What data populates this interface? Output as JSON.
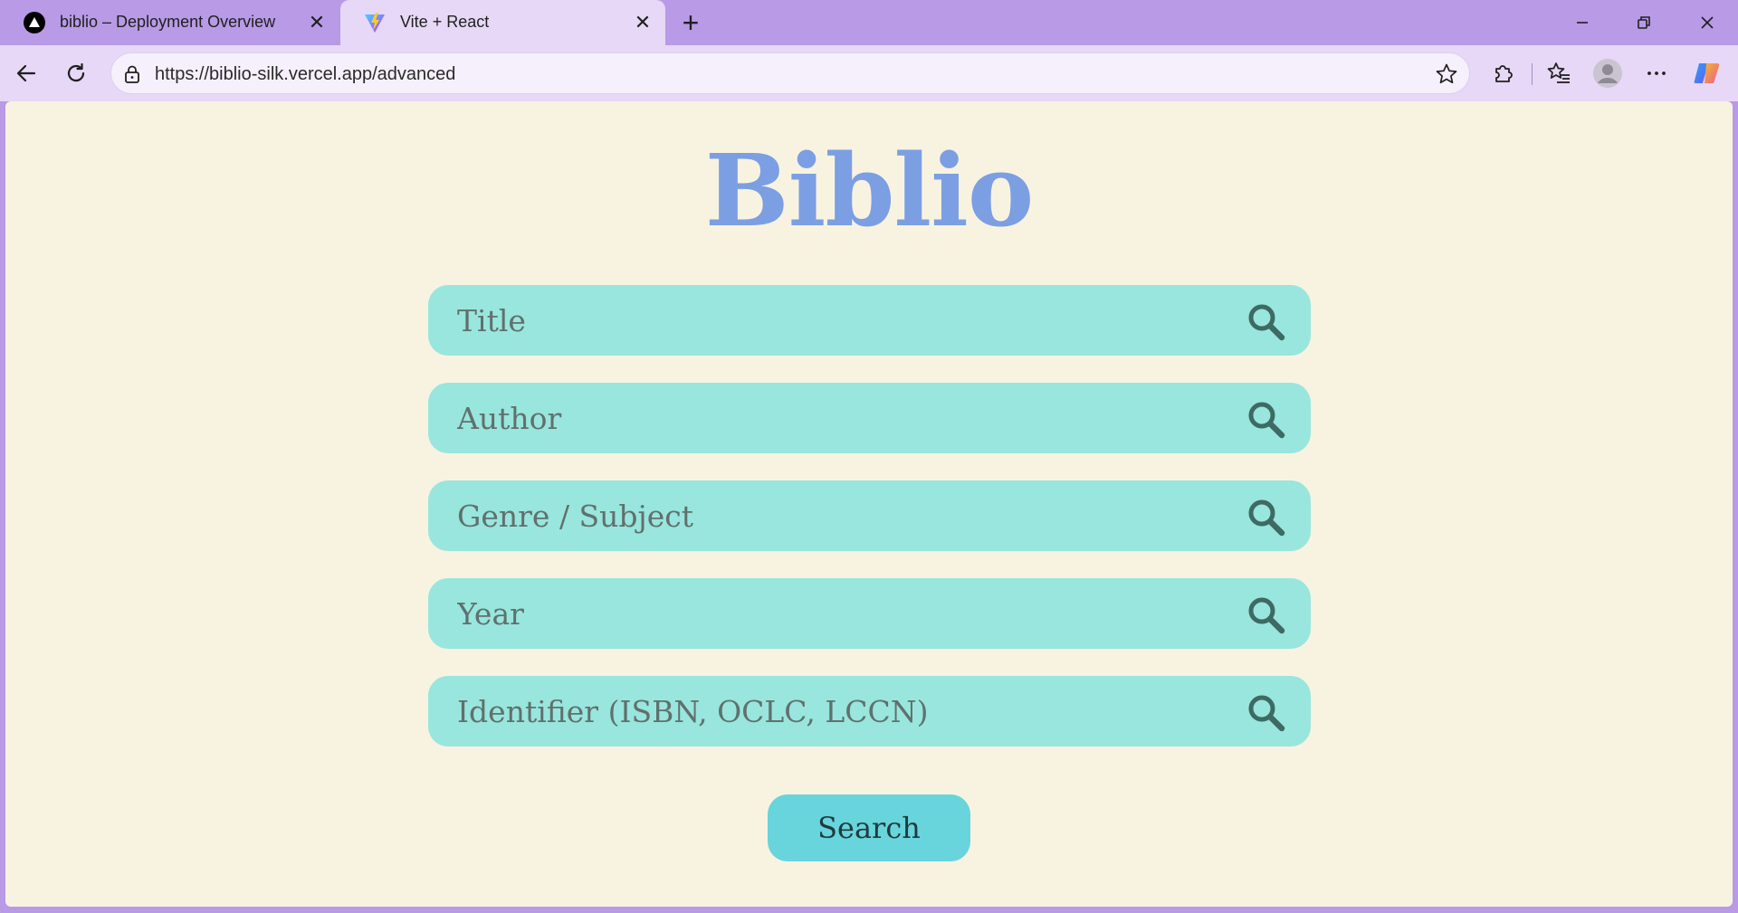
{
  "browser": {
    "tabs": [
      {
        "title": "biblio – Deployment Overview",
        "icon": "vercel-icon",
        "active": false
      },
      {
        "title": "Vite + React",
        "icon": "vite-icon",
        "active": true
      }
    ],
    "close_glyph": "✕",
    "new_tab_glyph": "+",
    "address": {
      "url": "https://biblio-silk.vercel.app/advanced"
    }
  },
  "app": {
    "logo": "Biblio",
    "fields": [
      {
        "placeholder": "Title"
      },
      {
        "placeholder": "Author"
      },
      {
        "placeholder": "Genre / Subject"
      },
      {
        "placeholder": "Year"
      },
      {
        "placeholder": "Identifier (ISBN, OCLC, LCCN)"
      }
    ],
    "search_label": "Search"
  },
  "colors": {
    "browser_frame": "#b99ae6",
    "page_background": "#f8f3e1",
    "logo": "#7b9fe2",
    "field_background": "#98e6de",
    "button_background": "#68d4dc"
  }
}
